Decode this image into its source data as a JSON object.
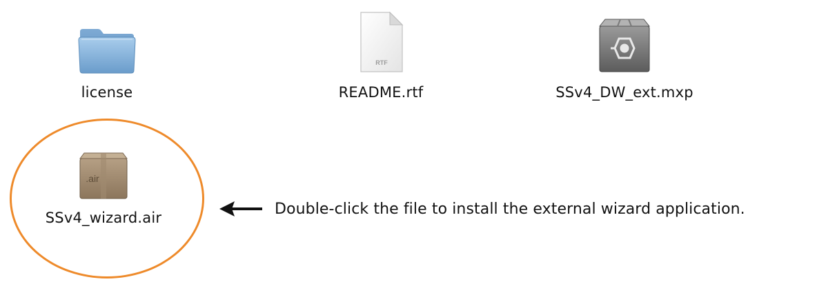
{
  "files": [
    {
      "name": "license",
      "icon": "folder-icon"
    },
    {
      "name": "README.rtf",
      "icon": "rtf-document-icon",
      "badge": "RTF"
    },
    {
      "name": "SSv4_DW_ext.mxp",
      "icon": "extension-package-icon"
    },
    {
      "name": "SSv4_wizard.air",
      "icon": "air-package-icon",
      "badge": ".air"
    }
  ],
  "callout": {
    "text": "Double-click the file to install the external wizard application.",
    "icon": "left-arrow-icon"
  },
  "colors": {
    "highlight": "#ee8a2a",
    "folder": "#8ab6dc",
    "box": "#a48e72"
  }
}
